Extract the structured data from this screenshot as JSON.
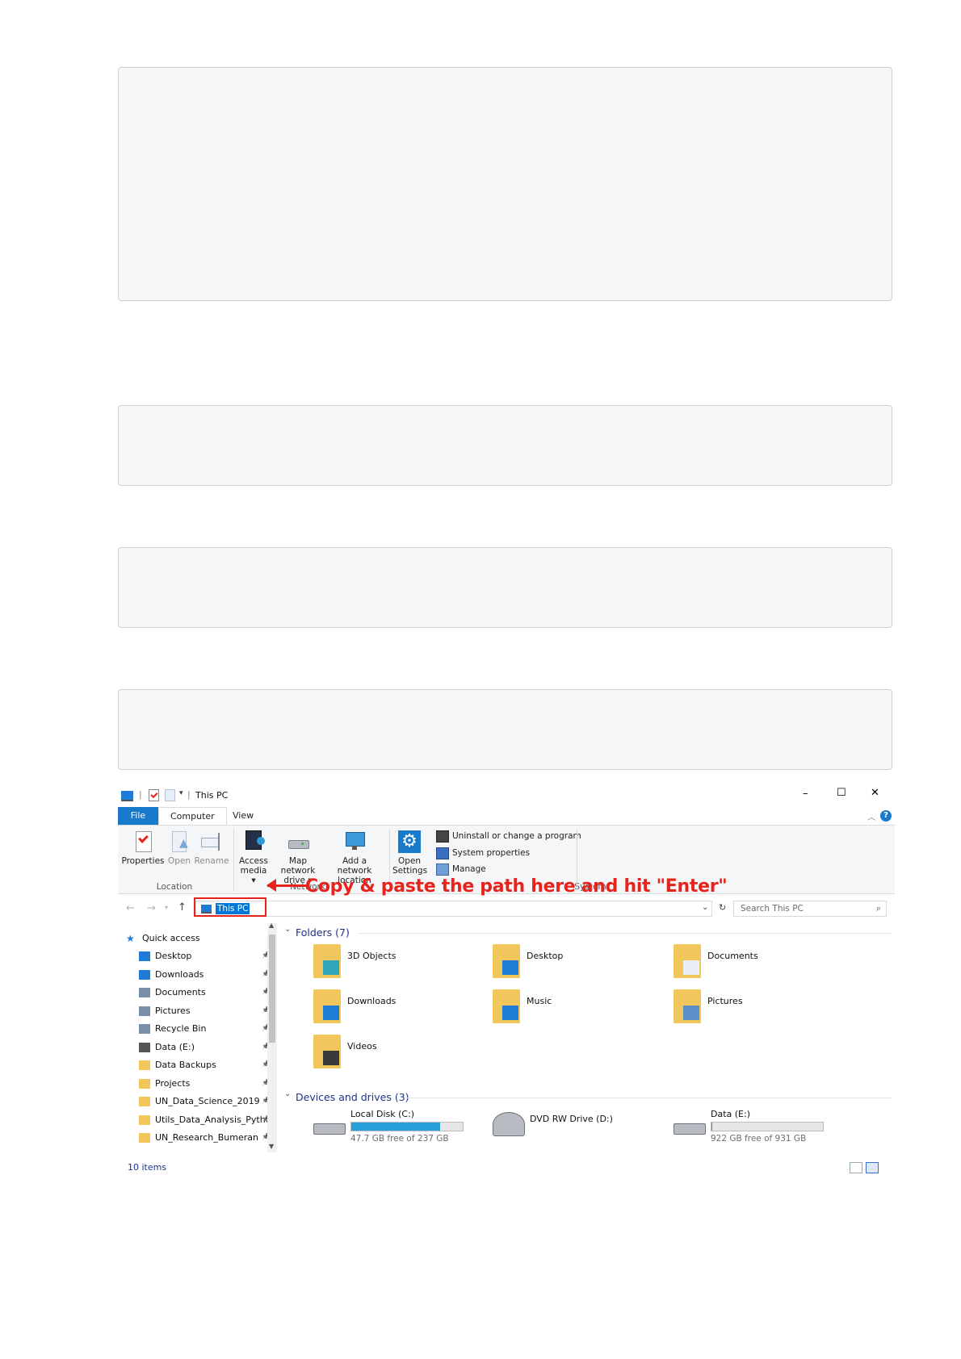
{
  "titlebar": {
    "title": "This PC",
    "quick_access_sep": "|",
    "minimize": "–",
    "maximize": "☐",
    "close": "✕"
  },
  "ribbon_tabs": {
    "file": "File",
    "computer": "Computer",
    "view": "View"
  },
  "ribbon": {
    "location": {
      "label": "Location",
      "buttons": [
        "Properties",
        "Open",
        "Rename"
      ]
    },
    "network": {
      "label": "Network",
      "access_media": [
        "Access",
        "media ▾"
      ],
      "map_drive": [
        "Map network",
        "drive ▾"
      ],
      "add_location": [
        "Add a network",
        "location"
      ]
    },
    "system": {
      "label": "System",
      "open_settings": [
        "Open",
        "Settings"
      ],
      "items": [
        "Uninstall or change a program",
        "System properties",
        "Manage"
      ]
    }
  },
  "address": {
    "path": "This PC",
    "search_placeholder": "Search This PC",
    "callout": "Copy & paste the path here and hit \"Enter\""
  },
  "nav": {
    "header": "Quick access",
    "items": [
      {
        "label": "Desktop",
        "icon": "desktop-icon",
        "color": "#1e7bd6"
      },
      {
        "label": "Downloads",
        "icon": "download-arrow-icon",
        "color": "#1e7bd6"
      },
      {
        "label": "Documents",
        "icon": "documents-icon",
        "color": "#7a8fa8"
      },
      {
        "label": "Pictures",
        "icon": "pictures-icon",
        "color": "#7a8fa8"
      },
      {
        "label": "Recycle Bin",
        "icon": "recycle-bin-icon",
        "color": "#7a8fa8"
      },
      {
        "label": "Data (E:)",
        "icon": "drive-icon",
        "color": "#555555"
      },
      {
        "label": "Data Backups",
        "icon": "folder-icon",
        "color": "#f1c75b"
      },
      {
        "label": "Projects",
        "icon": "folder-icon",
        "color": "#f1c75b"
      },
      {
        "label": "UN_Data_Science_2019",
        "icon": "folder-icon",
        "color": "#f1c75b"
      },
      {
        "label": "Utils_Data_Analysis_Python",
        "icon": "folder-icon",
        "color": "#f1c75b"
      },
      {
        "label": "UN_Research_Bumeran",
        "icon": "folder-icon",
        "color": "#f1c75b"
      }
    ]
  },
  "folders": {
    "header": "Folders (7)",
    "items": [
      "3D Objects",
      "Desktop",
      "Documents",
      "Downloads",
      "Music",
      "Pictures",
      "Videos"
    ]
  },
  "drives": {
    "header": "Devices and drives (3)",
    "items": [
      {
        "label": "Local Disk (C:)",
        "free": "47.7 GB free of 237 GB",
        "used_fraction": 0.8
      },
      {
        "label": "DVD RW Drive (D:)",
        "free": "",
        "used_fraction": null
      },
      {
        "label": "Data (E:)",
        "free": "922 GB free of 931 GB",
        "used_fraction": 0.01
      }
    ]
  },
  "status": {
    "count": "10 items"
  },
  "colors": {
    "accent": "#1979ca",
    "callout": "#e8231c",
    "folder": "#f1c75b",
    "drive_bar": "#26a0da"
  }
}
